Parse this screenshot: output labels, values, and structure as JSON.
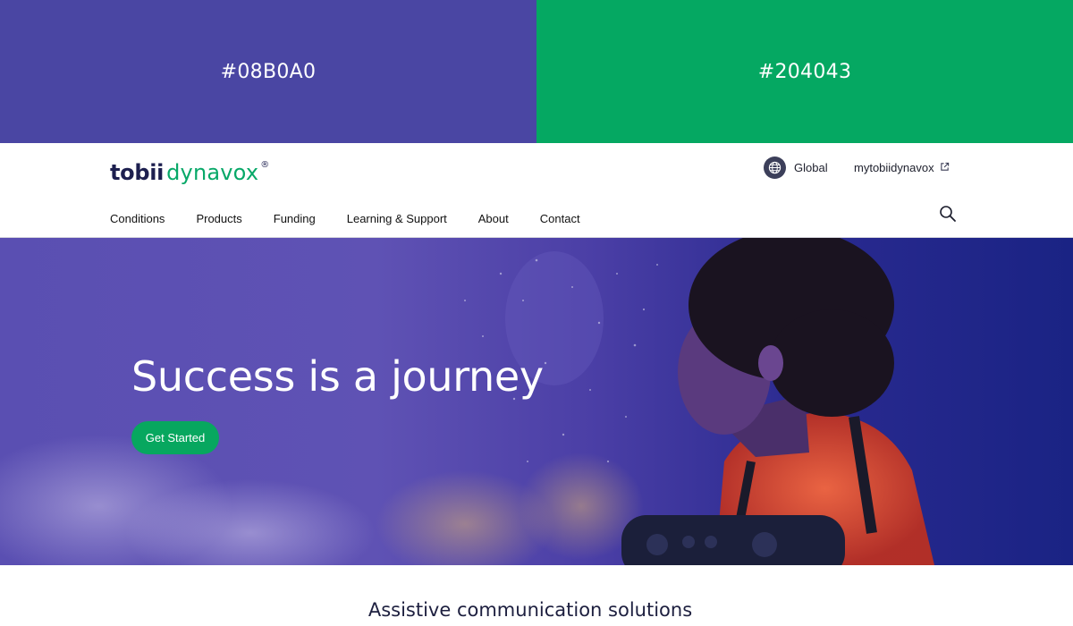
{
  "swatches": {
    "left": {
      "label": "#08B0A0",
      "color": "#4a46a3"
    },
    "right": {
      "label": "#204043",
      "color": "#05a862"
    }
  },
  "brand": {
    "part1": "tobii",
    "part2": "dynavox",
    "reg": "®"
  },
  "header": {
    "global_label": "Global",
    "account_link": "mytobiidynavox"
  },
  "nav": {
    "items": [
      "Conditions",
      "Products",
      "Funding",
      "Learning & Support",
      "About",
      "Contact"
    ]
  },
  "hero": {
    "title": "Success is a journey",
    "cta": "Get Started"
  },
  "section": {
    "title": "Assistive communication solutions"
  },
  "icons": [
    "globe-icon",
    "external-link-icon",
    "search-icon"
  ]
}
